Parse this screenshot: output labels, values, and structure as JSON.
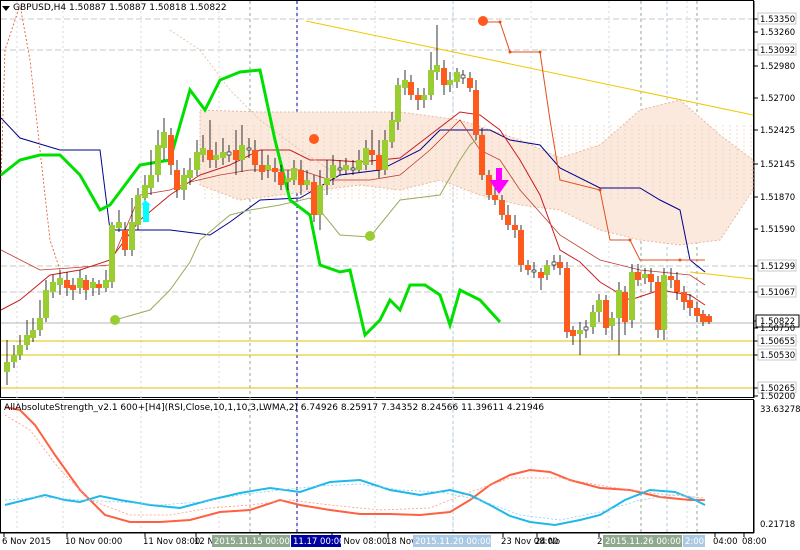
{
  "header": {
    "symbol": "GBPUSD,H4",
    "open": "1.50887",
    "high": "1.50887",
    "low": "1.50818",
    "close": "1.50822"
  },
  "price_axis": {
    "labels": [
      "1.53350",
      "1.53260",
      "1.53092",
      "1.52980",
      "1.52700",
      "1.52425",
      "1.52145",
      "1.51870",
      "1.51590",
      "1.51299",
      "1.51067",
      "1.50822",
      "1.50750",
      "1.50655",
      "1.50530",
      "1.50265",
      "1.50200"
    ],
    "highlighted": [
      "1.53350",
      "1.53092",
      "1.51299",
      "1.51067",
      "1.50655",
      "1.50530",
      "1.50265"
    ],
    "current": "1.50822"
  },
  "indicator": {
    "title": "AllAbsoluteStrength_v2.1 600+[H4](RSI,Close,10,1,10,3,LWMA,2) 6.74926 8.25917 7.34352 8.24566 11.39611 4.21946",
    "max_label": "33.63278",
    "min_label": "0.21718"
  },
  "time_axis": {
    "labels": [
      "6 Nov 2015",
      "10 Nov 00:00",
      "11 Nov 08:00",
      "12 N",
      "13 Nov 16:00",
      "17 Nov 08:00",
      "18 Nov",
      "23 Nov 08:00",
      "24 No",
      "25 Nov 16:00",
      "04:00",
      "08:00"
    ],
    "highlights": [
      {
        "text": "2015.11.15 00:00",
        "color": "#8fa98f"
      },
      {
        "text": "11.17 00:00",
        "color": "#0000a0"
      },
      {
        "text": "2015.11.20 00:00",
        "color": "#a9c9e4"
      },
      {
        "text": "2015.11.26 00:00",
        "color": "#8fa98f"
      },
      {
        "text": "2:00",
        "color": "#a9c9e4"
      }
    ]
  },
  "colors": {
    "bull": "#9acd32",
    "bear": "#ff5a1e",
    "strength_line": "#00e000",
    "kijun": "#c81e1e",
    "tenkan": "#00008b",
    "chikou": "#9aab5a",
    "trendline": "#f0c800",
    "arrow_up": "#00ffff",
    "arrow_down": "#ff00ff"
  }
}
